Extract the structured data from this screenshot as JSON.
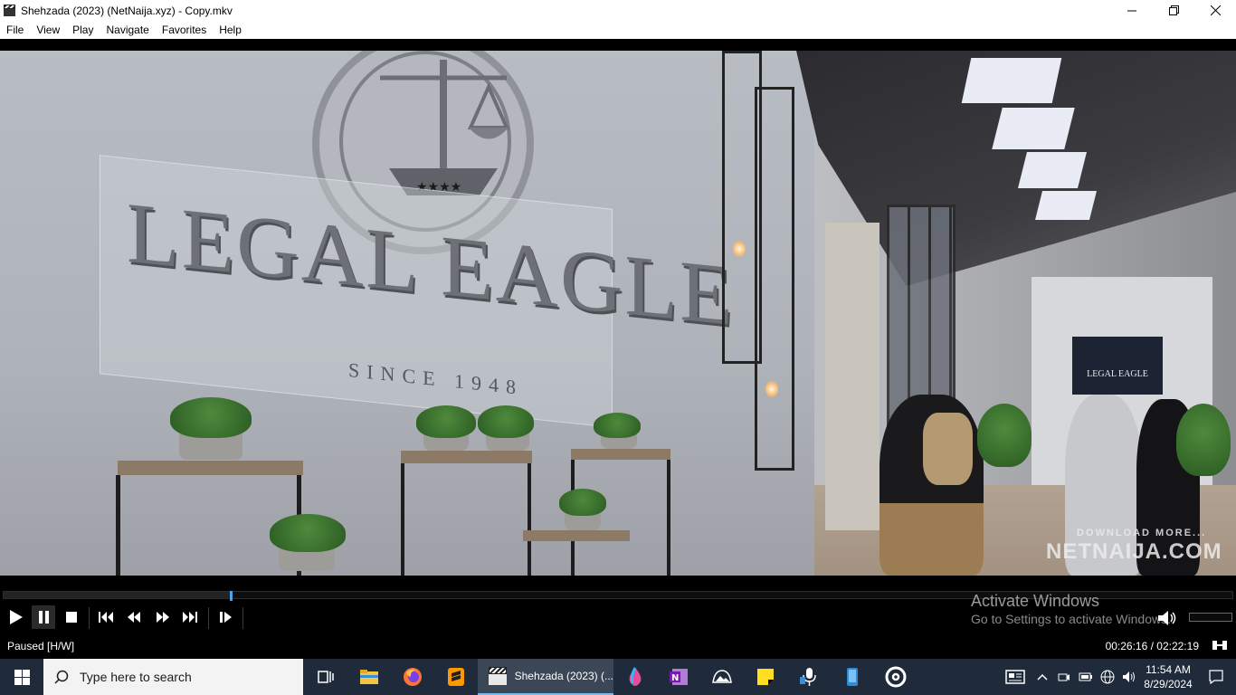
{
  "window": {
    "title": "Shehzada (2023) (NetNaija.xyz) - Copy.mkv",
    "minimize_glyph": "—",
    "maximize_glyph": "❐",
    "close_glyph": "✕"
  },
  "menu": {
    "items": [
      "File",
      "View",
      "Play",
      "Navigate",
      "Favorites",
      "Help"
    ]
  },
  "video": {
    "logo_text": "LEGAL EAGLE",
    "logo_sub": "SINCE 1948",
    "poster_text": "LEGAL EAGLE",
    "watermark_line1": "DOWNLOAD MORE...",
    "watermark_line2": "NETNAIJA.COM"
  },
  "seek": {
    "progress_fraction": 0.185
  },
  "activation": {
    "title": "Activate Windows",
    "subtitle": "Go to Settings to activate Windows."
  },
  "status": {
    "state": "Paused [H/W]",
    "time": "00:26:16 / 02:22:19"
  },
  "taskbar": {
    "search_placeholder": "Type here to search",
    "active_app_label": "Shehzada (2023) (...",
    "clock_time": "11:54 AM",
    "clock_date": "8/29/2024"
  },
  "colors": {
    "accent": "#4aa3e8",
    "taskbar": "#1f2b3a"
  }
}
